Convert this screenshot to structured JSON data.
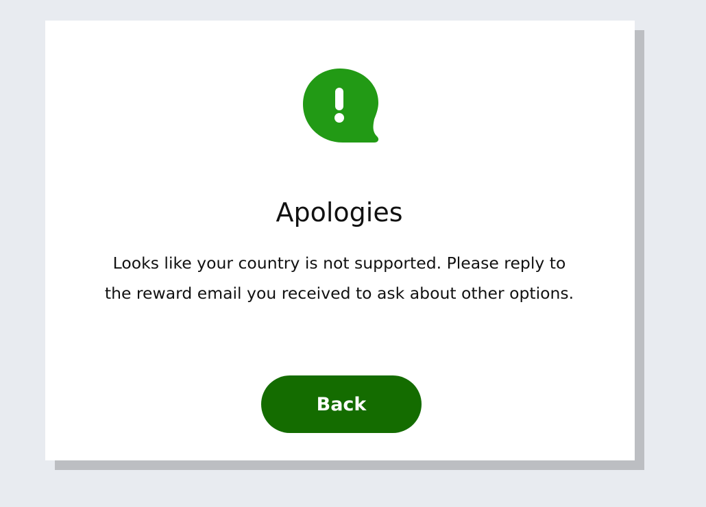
{
  "dialog": {
    "icon": "alert-chat-bubble-icon",
    "title": "Apologies",
    "message": "Looks like your country is not supported. Please reply to the reward email you received to ask about other options.",
    "back_label": "Back"
  },
  "colors": {
    "background": "#e8ebf0",
    "card": "#ffffff",
    "card_shadow": "#bcbec2",
    "icon_green": "#229a15",
    "button_green": "#146c00",
    "text": "#111111"
  }
}
